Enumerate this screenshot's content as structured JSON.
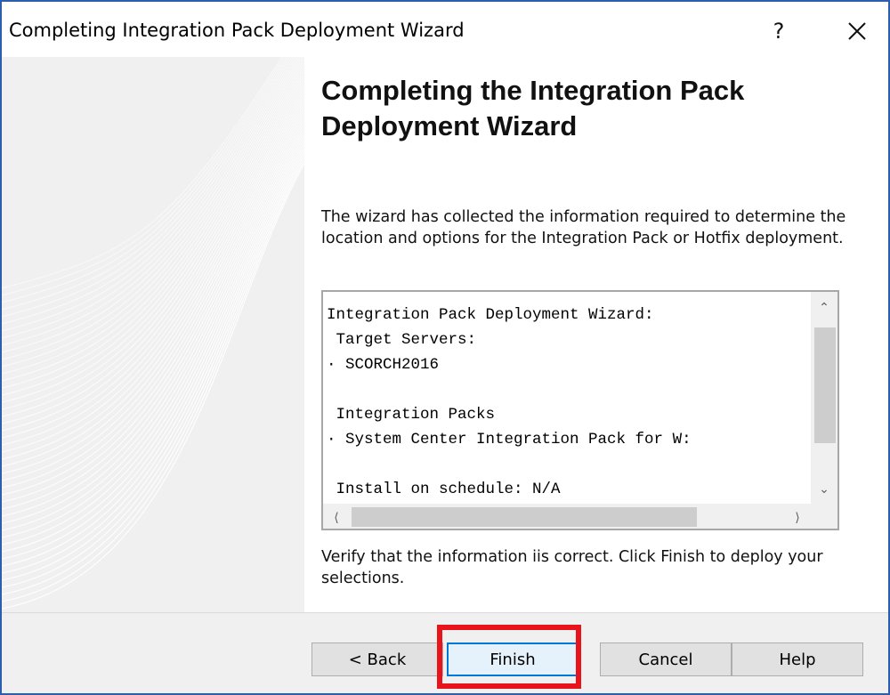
{
  "window": {
    "title": "Completing Integration Pack Deployment Wizard",
    "help_label": "?",
    "accent_color": "#2b5fae"
  },
  "heading": "Completing the Integration Pack Deployment Wizard",
  "description": "The wizard has collected the information required to determine the location and options for the Integration Pack or Hotfix deployment.",
  "summary": {
    "lines": [
      "Integration Pack Deployment Wizard:",
      " Target Servers:",
      "· SCORCH2016",
      "",
      " Integration Packs",
      "· System Center Integration Pack for W:",
      "",
      " Install on schedule: N/A"
    ]
  },
  "verify_text": "Verify that the information iis correct.  Click Finish to deploy your selections.",
  "buttons": {
    "back": "< Back",
    "finish": "Finish",
    "cancel": "Cancel",
    "help": "Help"
  },
  "highlight_color": "#e8141c"
}
